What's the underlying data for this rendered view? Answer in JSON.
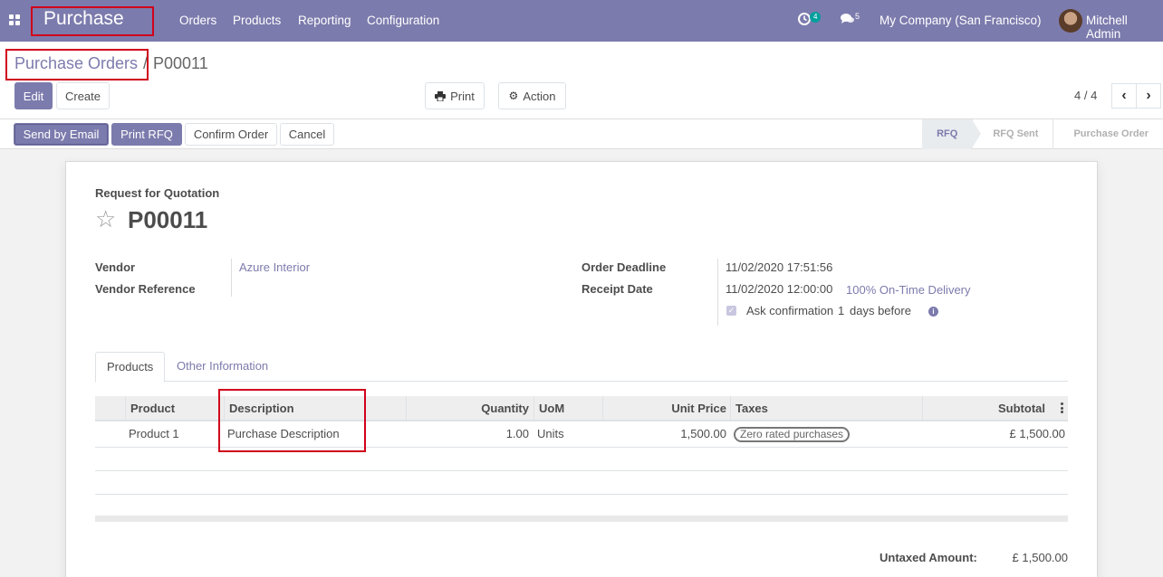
{
  "navbar": {
    "apps_icon": "grid-icon",
    "brand": "Purchase",
    "menu": [
      "Orders",
      "Products",
      "Reporting",
      "Configuration"
    ],
    "activity_count": "4",
    "messages_count": "5",
    "company": "My Company (San Francisco)",
    "user": "Mitchell Admin"
  },
  "breadcrumb": {
    "parent": "Purchase Orders",
    "separator": "/",
    "current": "P00011"
  },
  "toolbar": {
    "edit": "Edit",
    "create": "Create",
    "print": "Print",
    "action": "Action",
    "pager": "4 / 4"
  },
  "statusbar": {
    "buttons": [
      "Send by Email",
      "Print RFQ",
      "Confirm Order",
      "Cancel"
    ],
    "stages": [
      "RFQ",
      "RFQ Sent",
      "Purchase Order"
    ],
    "active_stage": "RFQ"
  },
  "form": {
    "doc_type": "Request for Quotation",
    "name": "P00011",
    "vendor_label": "Vendor",
    "vendor_value": "Azure Interior",
    "vendor_ref_label": "Vendor Reference",
    "vendor_ref_value": "",
    "deadline_label": "Order Deadline",
    "deadline_value": "11/02/2020 17:51:56",
    "receipt_label": "Receipt Date",
    "receipt_value": "11/02/2020 12:00:00",
    "on_time": "100% On-Time Delivery",
    "ask_confirm_prefix": "Ask confirmation",
    "ask_confirm_days": "1",
    "ask_confirm_suffix": "days before",
    "ask_confirm_checked": true
  },
  "tabs": [
    "Products",
    "Other Information"
  ],
  "lines": {
    "headers": {
      "product": "Product",
      "description": "Description",
      "quantity": "Quantity",
      "uom": "UoM",
      "unit_price": "Unit Price",
      "taxes": "Taxes",
      "subtotal": "Subtotal"
    },
    "rows": [
      {
        "product": "Product 1",
        "description": "Purchase Description",
        "quantity": "1.00",
        "uom": "Units",
        "unit_price": "1,500.00",
        "taxes": "Zero rated purchases",
        "subtotal": "£ 1,500.00"
      }
    ]
  },
  "totals": {
    "untaxed_label": "Untaxed Amount:",
    "untaxed_value": "£ 1,500.00"
  },
  "colors": {
    "brand": "#7c7bad",
    "highlight": "#d0021b"
  }
}
